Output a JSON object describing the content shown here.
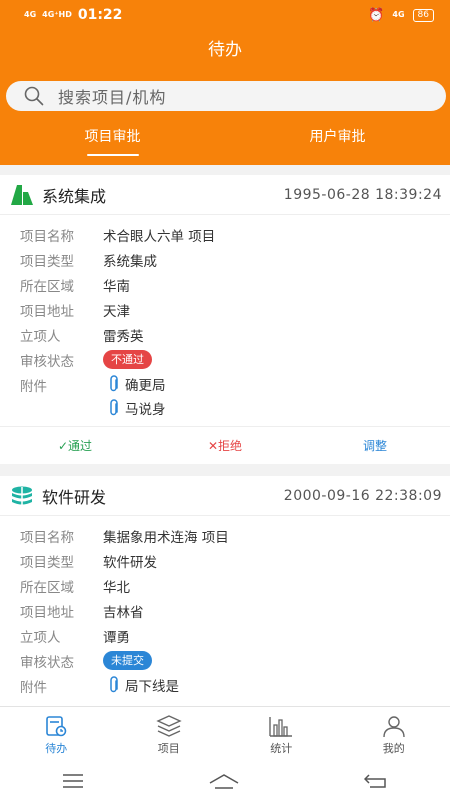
{
  "status_bar": {
    "time": "01:22",
    "signal1": "4G",
    "signal2": "4G⁺HD",
    "battery": "86"
  },
  "header": {
    "title": "待办"
  },
  "search": {
    "placeholder": "搜索项目/机构"
  },
  "tabs": [
    {
      "label": "项目审批",
      "active": true
    },
    {
      "label": "用户审批",
      "active": false
    }
  ],
  "labels": {
    "name": "项目名称",
    "type": "项目类型",
    "region": "所在区域",
    "address": "项目地址",
    "creator": "立项人",
    "status": "审核状态",
    "attachments": "附件"
  },
  "cards": [
    {
      "title": "系统集成",
      "date": "1995-06-28 18:39:24",
      "icon": "green-building-icon",
      "project_name": "术合眼人六单 项目",
      "project_type": "系统集成",
      "region": "华南",
      "address": "天津",
      "creator": "雷秀英",
      "status": "不通过",
      "status_color": "#e54545",
      "attachments": [
        "确更局",
        "马说身"
      ],
      "actions": {
        "pass": "✓通过",
        "reject": "✕拒绝",
        "adjust": "调整"
      }
    },
    {
      "title": "软件研发",
      "date": "2000-09-16 22:38:09",
      "icon": "teal-database-icon",
      "project_name": "集据象用术连海 项目",
      "project_type": "软件研发",
      "region": "华北",
      "address": "吉林省",
      "creator": "谭勇",
      "status": "未提交",
      "status_color": "#2b86d6",
      "attachments": [
        "局下线是"
      ]
    }
  ],
  "bottom_nav": [
    {
      "label": "待办",
      "icon": "todo-icon",
      "active": true
    },
    {
      "label": "项目",
      "icon": "layers-icon",
      "active": false
    },
    {
      "label": "统计",
      "icon": "bar-chart-icon",
      "active": false
    },
    {
      "label": "我的",
      "icon": "user-icon",
      "active": false
    }
  ],
  "colors": {
    "primary": "#f7820a",
    "accent": "#2b86d6",
    "pass": "#27a052",
    "reject": "#e54545"
  }
}
